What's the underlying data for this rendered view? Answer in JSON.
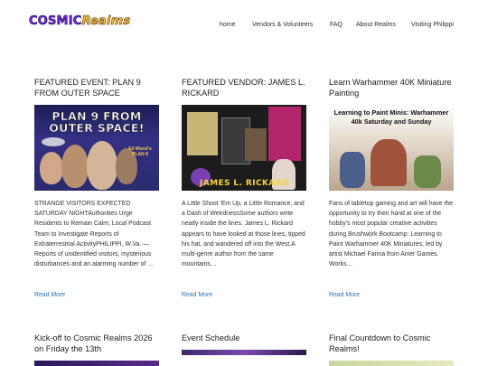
{
  "site": {
    "logo_part1": "COSMIC",
    "logo_part2": "Realms"
  },
  "nav": [
    "home",
    "Vendors & Volunteers",
    "FAQ",
    "About Realms",
    "Visiting Philippi"
  ],
  "read_more": "Read More",
  "posts": [
    {
      "title": "FEATURED EVENT: PLAN 9 FROM OUTER SPACE",
      "image_text": "PLAN 9 FROM OUTER SPACE!",
      "image_badge": "Ed Wood's PLAN 9",
      "excerpt": "STRANGE VISITORS EXPECTED SATURDAY NIGHTAuthorities Urge Residents to Remain Calm; Local Podcast Team to Investigate Reports of Extraterrestrial ActivityPHILIPPI, W.Va. — Reports of unidentified visitors, mysterious disturbances and an alarming number of …"
    },
    {
      "title": "FEATURED VENDOR: JAMES L. RICKARD",
      "image_text": "JAMES L. RICKARD",
      "excerpt": "A Little Shoot 'Em Up, a Little Romance, and a Dash of WeirdnessSome authors write neatly inside the lines. James L. Rickard appears to have looked at those lines, tipped his hat, and wandered off into the West.A multi-genre author from the same mountains…"
    },
    {
      "title": "Learn Warhammer 40K Miniature Painting",
      "image_text": "Learning to Paint Minis: Warhammer 40k Saturday and Sunday",
      "excerpt": "Fans of tabletop gaming and art will have the opportunity to try their hand at one of the hobby's most popular creative activities during Brushwork Bootcamp: Learning to Paint Warhammer 40K Miniatures, led by artist Michael Farina from Airier Games. Works…"
    },
    {
      "title": "Kick-off to Cosmic Realms 2026 on Friday the 13th"
    },
    {
      "title": "Event Schedule"
    },
    {
      "title": "Final Countdown to Cosmic Realms!"
    }
  ],
  "colors": {
    "link": "#2f6fb0",
    "logo_purple": "#6a2bd6",
    "logo_gold": "#f2c43a"
  }
}
